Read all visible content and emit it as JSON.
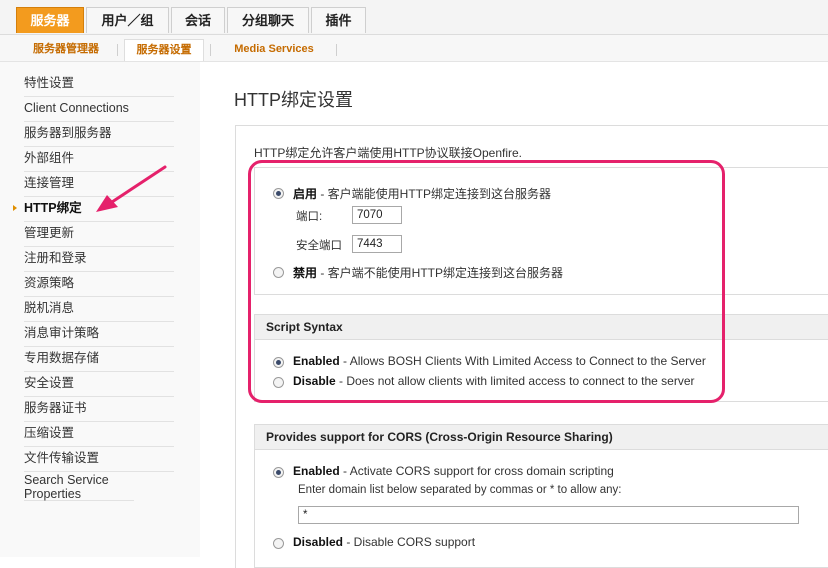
{
  "topnav": {
    "tabs": [
      {
        "label": "服务器"
      },
      {
        "label": "用户／组"
      },
      {
        "label": "会话"
      },
      {
        "label": "分组聊天"
      },
      {
        "label": "插件"
      }
    ]
  },
  "subnav": {
    "tabs": [
      {
        "label": "服务器管理器"
      },
      {
        "label": "服务器设置"
      },
      {
        "label": "Media Services"
      }
    ]
  },
  "sidebar": {
    "items": [
      {
        "label": "特性设置"
      },
      {
        "label": "Client Connections"
      },
      {
        "label": "服务器到服务器"
      },
      {
        "label": "外部组件"
      },
      {
        "label": "连接管理"
      },
      {
        "label": "HTTP绑定"
      },
      {
        "label": "管理更新"
      },
      {
        "label": "注册和登录"
      },
      {
        "label": "资源策略"
      },
      {
        "label": "脱机消息"
      },
      {
        "label": "消息审计策略"
      },
      {
        "label": "专用数据存储"
      },
      {
        "label": "安全设置"
      },
      {
        "label": "服务器证书"
      },
      {
        "label": "压缩设置"
      },
      {
        "label": "文件传输设置"
      },
      {
        "label": "Search Service Properties"
      }
    ]
  },
  "main": {
    "title": "HTTP绑定设置",
    "description": "HTTP绑定允许客户端使用HTTP协议联接Openfire.",
    "binding": {
      "enabled_label": "启用",
      "enabled_desc": " - 客户端能使用HTTP绑定连接到这台服务器",
      "port_label": "端口:",
      "port_value": "7070",
      "secure_port_label": "安全端口",
      "secure_port_value": "7443",
      "disabled_label": "禁用",
      "disabled_desc": " - 客户端不能使用HTTP绑定连接到这台服务器"
    },
    "script_syntax": {
      "header": "Script Syntax",
      "enabled_label": "Enabled",
      "enabled_desc": " - Allows BOSH Clients With Limited Access to Connect to the Server",
      "disabled_label": "Disable",
      "disabled_desc": " - Does not allow clients with limited access to connect to the server"
    },
    "cors": {
      "header": "Provides support for CORS (Cross-Origin Resource Sharing)",
      "enabled_label": "Enabled",
      "enabled_desc": " - Activate CORS support for cross domain scripting",
      "domain_hint": "Enter domain list below separated by commas or * to allow any:",
      "domain_value": "*",
      "disabled_label": "Disabled",
      "disabled_desc": " - Disable CORS support"
    }
  },
  "colors": {
    "accent": "#f39b1e",
    "highlight": "#e5216b",
    "subnav_text": "#c56b00"
  }
}
